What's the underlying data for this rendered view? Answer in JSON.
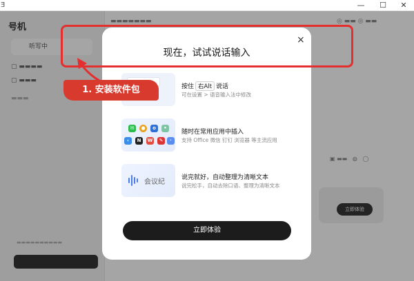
{
  "window": {
    "minimize_glyph": "—",
    "maximize_glyph": "☐",
    "close_glyph": "✕"
  },
  "background_app": {
    "app_title": "号机",
    "sidebar_tab": "听写中",
    "pill_button": "立即体验"
  },
  "modal": {
    "close_glyph": "×",
    "title": "现在，试试说话输入",
    "features": [
      {
        "head_prefix": "按住",
        "key": "右Alt",
        "head_suffix": "说话",
        "sub": "可在设置 > 语音输入法中修改"
      },
      {
        "head": "随时在常用应用中插入",
        "sub": "支持 Office 微信 钉钉 浏览器 等主流应用"
      },
      {
        "head": "说完就好，自动整理为清晰文本",
        "sub": "说完松手，自动去除口语、整理为清晰文本",
        "thumb_text": "会议纪"
      }
    ],
    "cta_label": "立即体验"
  },
  "annotation": {
    "label": "1. 安装软件包",
    "color": "#e52e2e"
  },
  "colors": {
    "cta_bg": "#1c1c1c",
    "accent_blue": "#4a7de8"
  }
}
